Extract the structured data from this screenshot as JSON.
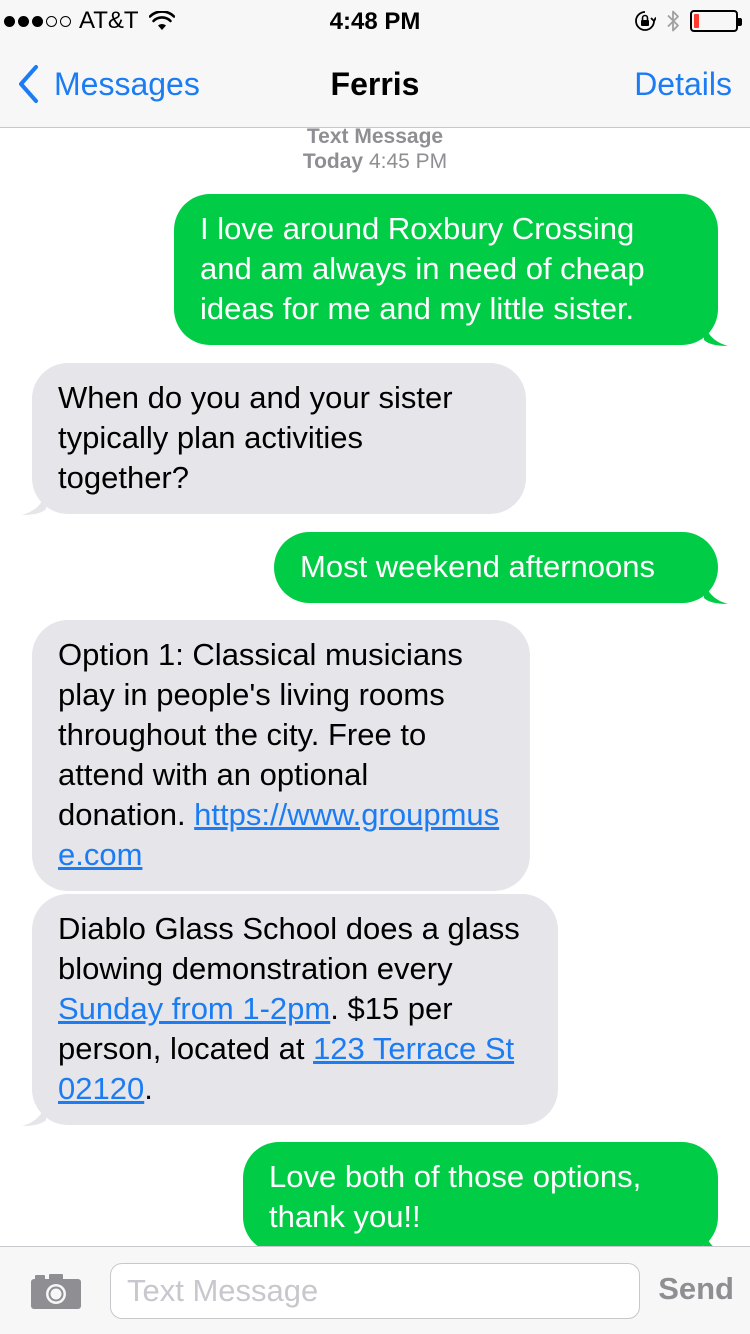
{
  "status_bar": {
    "carrier": "AT&T",
    "signal_bars_filled": 3,
    "signal_bars_total": 5,
    "time": "4:48 PM",
    "battery_level_fraction": 0.12,
    "battery_color": "#ff3b30"
  },
  "nav": {
    "back_label": "Messages",
    "title": "Ferris",
    "details_label": "Details"
  },
  "conversation": {
    "service_label": "Text Message",
    "date_label": "Today",
    "time_label": "4:45 PM",
    "messages": [
      {
        "direction": "sent",
        "text": "I love around Roxbury Crossing and am always in need of cheap ideas for me and my little sister."
      },
      {
        "direction": "received",
        "text": "When do you and your sister typically plan activities together?"
      },
      {
        "direction": "sent",
        "text": "Most weekend afternoons"
      },
      {
        "direction": "received",
        "text_before_link": "Option 1: Classical musicians play in people's living rooms throughout the city. Free to attend with an optional donation. ",
        "link": "https://www.groupmuse.com"
      },
      {
        "direction": "received",
        "part1": "Diablo Glass School does a glass blowing demonstration every ",
        "link_time": "Sunday from 1-2pm",
        "part2": ". $15 per person, located at ",
        "link_street": "123 Terrace St",
        "part3": " ",
        "link_zip": "02120",
        "part4": "."
      },
      {
        "direction": "sent",
        "text": "Love both of those options, thank you!!"
      }
    ]
  },
  "input_bar": {
    "placeholder": "Text Message",
    "send_label": "Send"
  },
  "colors": {
    "accent": "#1b7cf3",
    "sent_bubble": "#00cd45",
    "received_bubble": "#e5e5ea"
  },
  "icons": [
    "wifi-icon",
    "lock-rotation-icon",
    "bluetooth-icon",
    "battery-icon",
    "chevron-left-icon",
    "camera-icon"
  ]
}
